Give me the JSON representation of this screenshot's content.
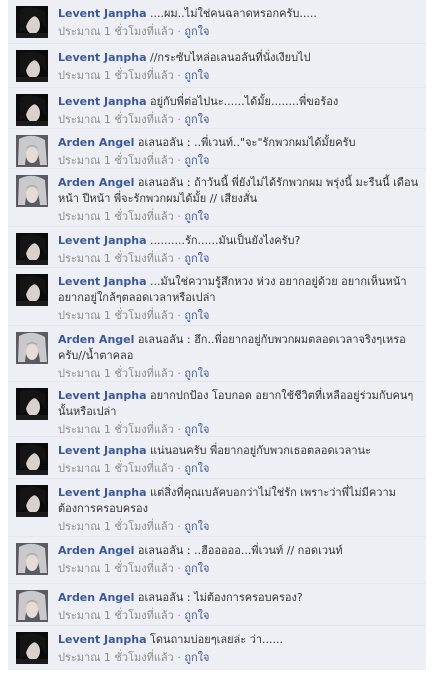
{
  "comments": [
    {
      "author": "Levent Janpha",
      "avatar": "dark-hair-avatar",
      "text": "....ผม..ไม่ใช่คนฉลาดหรอกครับ.....",
      "time": "ประมาณ 1 ชั่วโมงที่แล้ว",
      "sep": "·",
      "like": "ถูกใจ"
    },
    {
      "author": "Levent Janpha",
      "avatar": "dark-hair-avatar",
      "text": "//กระซับไหล่อเลนอลันที่นั่งเงียบไป",
      "time": "ประมาณ 1 ชั่วโมงที่แล้ว",
      "sep": "·",
      "like": "ถูกใจ"
    },
    {
      "author": "Levent Janpha",
      "avatar": "dark-hair-avatar",
      "text": "อยู่กับพี่ต่อไปนะ......ได้มั้ย........พี่ขอร้อง",
      "time": "ประมาณ 1 ชั่วโมงที่แล้ว",
      "sep": "·",
      "like": "ถูกใจ"
    },
    {
      "author": "Arden Angel",
      "avatar": "silver-hair-avatar",
      "text": "อเลนอลัน : ..พี่เวนท์..\"จะ\"รักพวกผมได้มั้ยครับ",
      "time": "ประมาณ 1 ชั่วโมงที่แล้ว",
      "sep": "·",
      "like": "ถูกใจ"
    },
    {
      "author": "Arden Angel",
      "avatar": "silver-hair-avatar",
      "text": "อเลนอลัน : ถ้าวันนี้ พี่ยังไม่ได้รักพวกผม พรุ่งนี้ มะรืนนี้ เดือนหน้า ปีหน้า พี่จะรักพวกผมได้มั้ย // เสียงสั่น",
      "time": "ประมาณ 1 ชั่วโมงที่แล้ว",
      "sep": "·",
      "like": "ถูกใจ"
    },
    {
      "author": "Levent Janpha",
      "avatar": "dark-hair-avatar",
      "text": "..........รัก......มันเป็นยังไงครับ?",
      "time": "ประมาณ 1 ชั่วโมงที่แล้ว",
      "sep": "·",
      "like": "ถูกใจ"
    },
    {
      "author": "Levent Janpha",
      "avatar": "dark-hair-avatar",
      "text": "...มันใช่ความรู้สึกหวง ห่วง อยากอยู่ด้วย อยากเห็นหน้า อยากอยู่ใกล้ๆตลอดเวลาหรือเปล่า",
      "time": "ประมาณ 1 ชั่วโมงที่แล้ว",
      "sep": "·",
      "like": "ถูกใจ"
    },
    {
      "author": "Arden Angel",
      "avatar": "silver-hair-avatar",
      "text": "อเลนอลัน : ฮึก..พี่อยากอยู่กับพวกผมตลอดเวลาจริงๆเหรอครับ//น้ำตาคลอ",
      "time": "ประมาณ 1 ชั่วโมงที่แล้ว",
      "sep": "·",
      "like": "ถูกใจ"
    },
    {
      "author": "Levent Janpha",
      "avatar": "dark-hair-avatar",
      "text": "อยากปกป้อง โอบกอด อยากใช้ชีวิตที่เหลืออยู่ร่วมกับคนๆนั้นหรือเปล่า",
      "time": "ประมาณ 1 ชั่วโมงที่แล้ว",
      "sep": "·",
      "like": "ถูกใจ"
    },
    {
      "author": "Levent Janpha",
      "avatar": "dark-hair-avatar",
      "text": "แน่นอนครับ พี่อยากอยู่กับพวกเธอตลอดเวลานะ",
      "time": "ประมาณ 1 ชั่วโมงที่แล้ว",
      "sep": "·",
      "like": "ถูกใจ"
    },
    {
      "author": "Levent Janpha",
      "avatar": "dark-hair-avatar",
      "text": "แต่สิ่งที่คุณเบลัคบอกว่าไม่ใช่รัก เพราะว่าพี่ไม่มีความต้องการครอบครอง",
      "time": "ประมาณ 1 ชั่วโมงที่แล้ว",
      "sep": "·",
      "like": "ถูกใจ"
    },
    {
      "author": "Arden Angel",
      "avatar": "silver-hair-avatar",
      "text": "อเลนอลัน : ..ฮือออออ...พี่เวนท์ // กอดเวนท์",
      "time": "ประมาณ 1 ชั่วโมงที่แล้ว",
      "sep": "·",
      "like": "ถูกใจ"
    },
    {
      "author": "Arden Angel",
      "avatar": "silver-hair-avatar",
      "text": "อเลนอลัน : ไม่ต้องการครอบครอง?",
      "time": "ประมาณ 1 ชั่วโมงที่แล้ว",
      "sep": "·",
      "like": "ถูกใจ"
    },
    {
      "author": "Levent Janpha",
      "avatar": "dark-hair-avatar",
      "text": "โดนถามบ่อยๆเลยล่ะ ว่า......",
      "time": "ประมาณ 1 ชั่วโมงที่แล้ว",
      "sep": "·",
      "like": "ถูกใจ"
    }
  ]
}
